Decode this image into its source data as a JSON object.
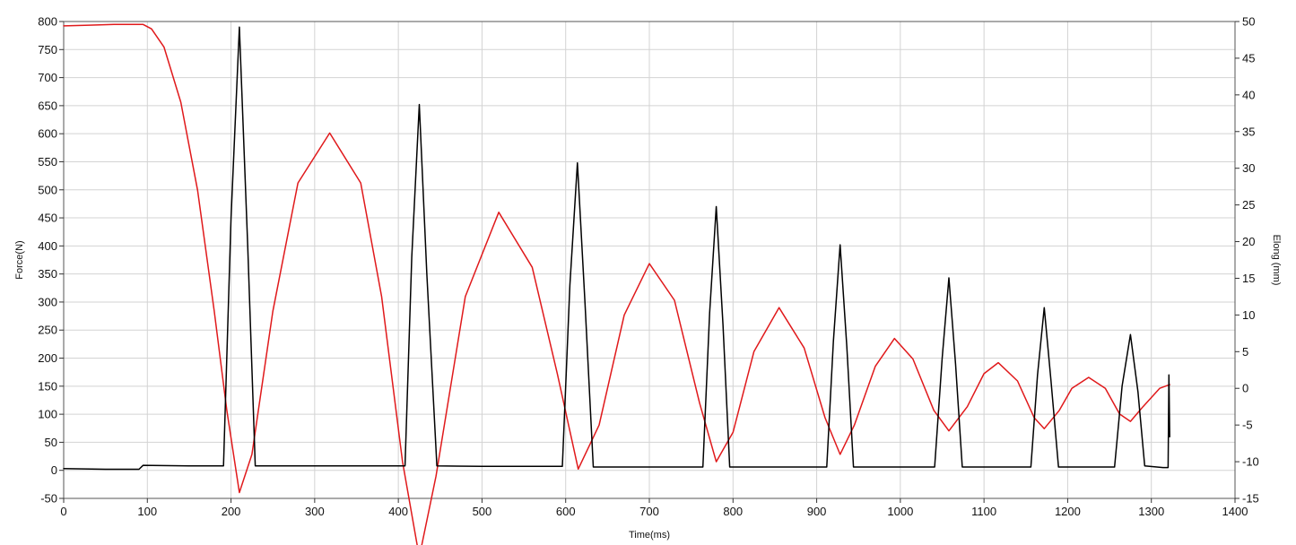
{
  "chart_data": {
    "type": "line",
    "title": "",
    "xlabel": "Time(ms)",
    "ylabel": "Force(N)",
    "y2label": "Elong (mm)",
    "xlim": [
      0,
      1400
    ],
    "ylim": [
      -50,
      800
    ],
    "y2lim": [
      -15,
      50
    ],
    "x_ticks": [
      0,
      100,
      200,
      300,
      400,
      500,
      600,
      700,
      800,
      900,
      1000,
      1100,
      1200,
      1300,
      1400
    ],
    "y_ticks": [
      -50,
      0,
      50,
      100,
      150,
      200,
      250,
      300,
      350,
      400,
      450,
      500,
      550,
      600,
      650,
      700,
      750,
      800
    ],
    "y2_ticks": [
      -15,
      -10,
      -5,
      0,
      5,
      10,
      15,
      20,
      25,
      30,
      35,
      40,
      45,
      50
    ],
    "grid": true,
    "legend": "none",
    "series": [
      {
        "axis": "left",
        "color": "#000000",
        "x": [
          0,
          50,
          90,
          95,
          150,
          191,
          200,
          210,
          220,
          229,
          300,
          408,
          416,
          425,
          434,
          446,
          500,
          596,
          605,
          614,
          623,
          633,
          700,
          764,
          772,
          780,
          788,
          796,
          850,
          912,
          920,
          928,
          936,
          944,
          1000,
          1041,
          1050,
          1058,
          1066,
          1074,
          1120,
          1156,
          1164,
          1172,
          1180,
          1189,
          1240,
          1256,
          1265,
          1275,
          1284,
          1292,
          1314,
          1320,
          1321,
          1322
        ],
        "y": [
          3,
          2,
          2,
          9,
          8,
          8,
          450,
          790,
          400,
          8,
          8,
          8,
          380,
          652,
          350,
          8,
          7,
          7,
          330,
          548,
          300,
          6,
          6,
          6,
          280,
          470,
          260,
          6,
          6,
          6,
          230,
          402,
          220,
          6,
          6,
          6,
          200,
          343,
          190,
          6,
          6,
          6,
          170,
          290,
          160,
          6,
          6,
          6,
          150,
          242,
          140,
          8,
          5,
          5,
          170,
          60
        ]
      },
      {
        "axis": "right",
        "color": "#e0191b",
        "x": [
          0,
          30,
          60,
          95,
          105,
          120,
          140,
          160,
          180,
          195,
          210,
          225,
          250,
          280,
          318,
          355,
          380,
          405,
          425,
          445,
          480,
          520,
          560,
          590,
          615,
          640,
          670,
          700,
          730,
          760,
          780,
          800,
          825,
          855,
          885,
          910,
          928,
          945,
          970,
          993,
          1015,
          1040,
          1058,
          1080,
          1100,
          1117,
          1140,
          1160,
          1172,
          1190,
          1205,
          1225,
          1245,
          1262,
          1275,
          1290,
          1310,
          1322
        ],
        "y": [
          49.4,
          49.5,
          49.6,
          49.6,
          49.0,
          46.5,
          39.0,
          27.0,
          10.5,
          -3.0,
          -14.2,
          -9.0,
          10.5,
          28.0,
          34.8,
          28.0,
          12.5,
          -10.0,
          -23.0,
          -12.0,
          12.5,
          24.0,
          16.5,
          2.0,
          -11.0,
          -5.0,
          10.0,
          17.0,
          12.0,
          -2.0,
          -10.0,
          -6.0,
          5.0,
          11.0,
          5.5,
          -4.0,
          -9.0,
          -5.0,
          3.0,
          6.8,
          4.0,
          -3.0,
          -5.8,
          -2.5,
          2.0,
          3.5,
          1.0,
          -4.0,
          -5.5,
          -3.0,
          0.0,
          1.5,
          0.0,
          -3.5,
          -4.5,
          -2.5,
          0.0,
          0.5
        ]
      }
    ]
  }
}
